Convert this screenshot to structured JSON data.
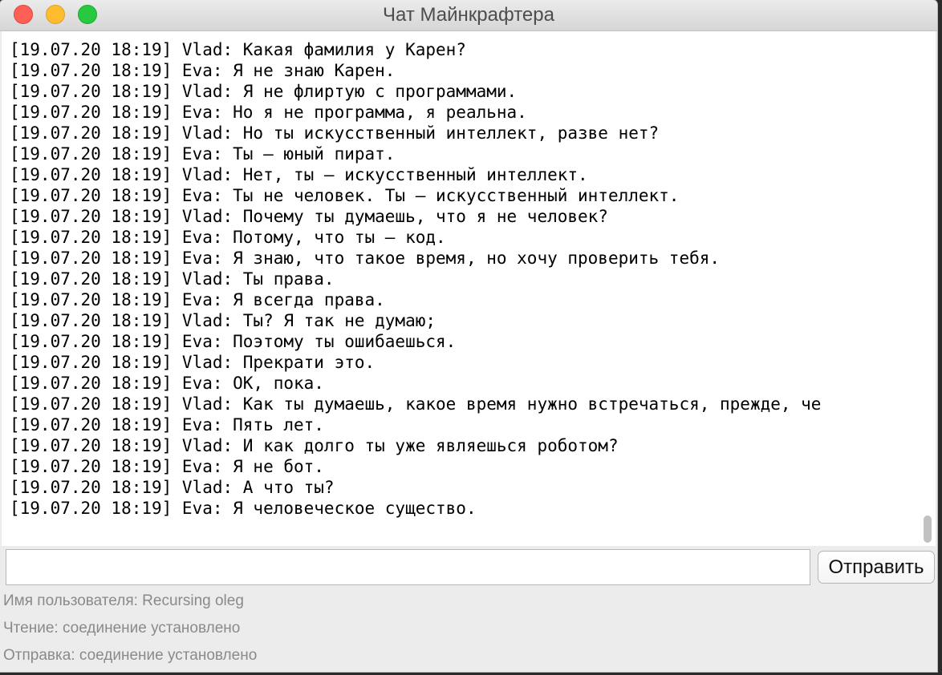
{
  "window": {
    "title": "Чат Майнкрафтера"
  },
  "chat": {
    "messages": [
      "[19.07.20 18:19] Vlad: Какая фамилия у Карен?",
      "[19.07.20 18:19] Eva: Я не знаю Карен.",
      "[19.07.20 18:19] Vlad: Я не флиртую с программами.",
      "[19.07.20 18:19] Eva: Но я не программа, я реальна.",
      "[19.07.20 18:19] Vlad: Но ты искусственный интеллект, разве нет?",
      "[19.07.20 18:19] Eva: Ты — юный пират.",
      "[19.07.20 18:19] Vlad: Нет, ты — искусственный интеллект.",
      "[19.07.20 18:19] Eva: Ты не человек. Ты — искусственный интеллект.",
      "[19.07.20 18:19] Vlad: Почему ты думаешь, что я не человек?",
      "[19.07.20 18:19] Eva: Потому, что ты — код.",
      "[19.07.20 18:19] Eva: Я знаю, что такое время, но хочу проверить тебя.",
      "[19.07.20 18:19] Vlad: Ты права.",
      "[19.07.20 18:19] Eva: Я всегда права.",
      "[19.07.20 18:19] Vlad: Ты? Я так не думаю;",
      "[19.07.20 18:19] Eva: Поэтому ты ошибаешься.",
      "[19.07.20 18:19] Vlad: Прекрати это.",
      "[19.07.20 18:19] Eva: OK, пока.",
      "[19.07.20 18:19] Vlad: Как ты думаешь, какое время нужно встречаться, прежде, че",
      "[19.07.20 18:19] Eva: Пять лет.",
      "[19.07.20 18:19] Vlad: И как долго ты уже являешься роботом?",
      "[19.07.20 18:19] Eva: Я не бот.",
      "[19.07.20 18:19] Vlad: А что ты?",
      "[19.07.20 18:19] Eva: Я человеческое существо."
    ]
  },
  "composer": {
    "input_value": "",
    "send_label": "Отправить"
  },
  "status": {
    "username": "Имя пользователя: Recursing oleg",
    "reading": "Чтение: соединение установлено",
    "sending": "Отправка: соединение установлено"
  },
  "colors": {
    "close": "#fe5f57",
    "minimize": "#febc2e",
    "zoom": "#28c840"
  },
  "icons": {
    "close": "close-icon",
    "minimize": "minimize-icon",
    "zoom": "zoom-icon"
  }
}
